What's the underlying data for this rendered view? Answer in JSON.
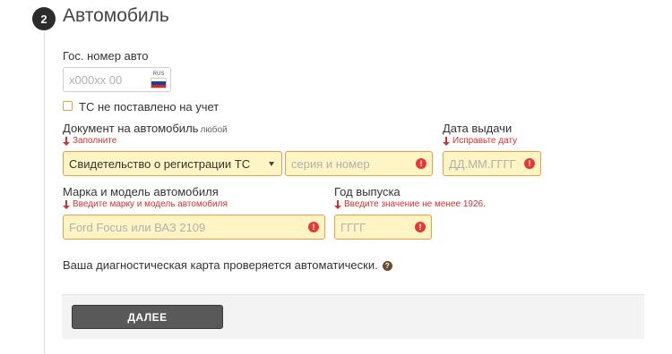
{
  "section": {
    "step_number": "2",
    "title": "Автомобиль"
  },
  "plate": {
    "label": "Гос. номер авто",
    "placeholder": "х000хх 00",
    "region_text": "RUS",
    "flag_colors": [
      "#ffffff",
      "#1c3f94",
      "#d52b1e"
    ]
  },
  "unregistered": {
    "label": "ТС не поставлено на учет",
    "checked": false
  },
  "document": {
    "label": "Документ на автомобиль",
    "hint": "любой",
    "error": "Заполните",
    "type_value": "Свидетельство о регистрации ТС",
    "number_placeholder": "серия и номер"
  },
  "issue_date": {
    "label": "Дата выдачи",
    "error": "Исправьте дату",
    "placeholder": "ДД.ММ.ГГГГ"
  },
  "model": {
    "label": "Марка и модель автомобиля",
    "error": "Введите марку и модель автомобиля",
    "placeholder": "Ford Focus или ВАЗ 2109"
  },
  "year": {
    "label": "Год выпуска",
    "error": "Введите значение не менее 1926.",
    "placeholder": "ГГГГ"
  },
  "info": {
    "text": "Ваша диагностическая карта проверяется автоматически."
  },
  "actions": {
    "next_label": "ДАЛЕЕ"
  },
  "colors": {
    "error_text": "#d32f2f",
    "error_field_bg": "#fff4c4",
    "error_field_border": "#ee9c4a",
    "button_bg": "#595959"
  }
}
